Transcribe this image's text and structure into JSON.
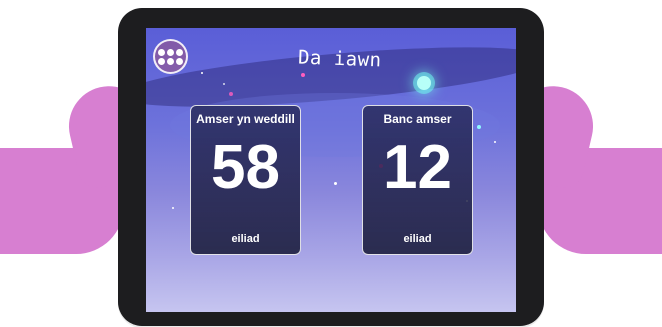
{
  "game": {
    "title": "Da iawn",
    "colors": {
      "hands": "#d77fd1",
      "tablet": "#1d1d1f",
      "screen_top": "#5a5ed7",
      "screen_bottom": "#c6c5f0",
      "card_border": "#ffffff",
      "text": "#ffffff"
    },
    "menu": {
      "icon": "grid-menu-icon"
    },
    "timers": [
      {
        "label": "Amser yn weddill",
        "value": "58",
        "unit": "eiliad"
      },
      {
        "label": "Banc amser",
        "value": "12",
        "unit": "eiliad"
      }
    ]
  }
}
